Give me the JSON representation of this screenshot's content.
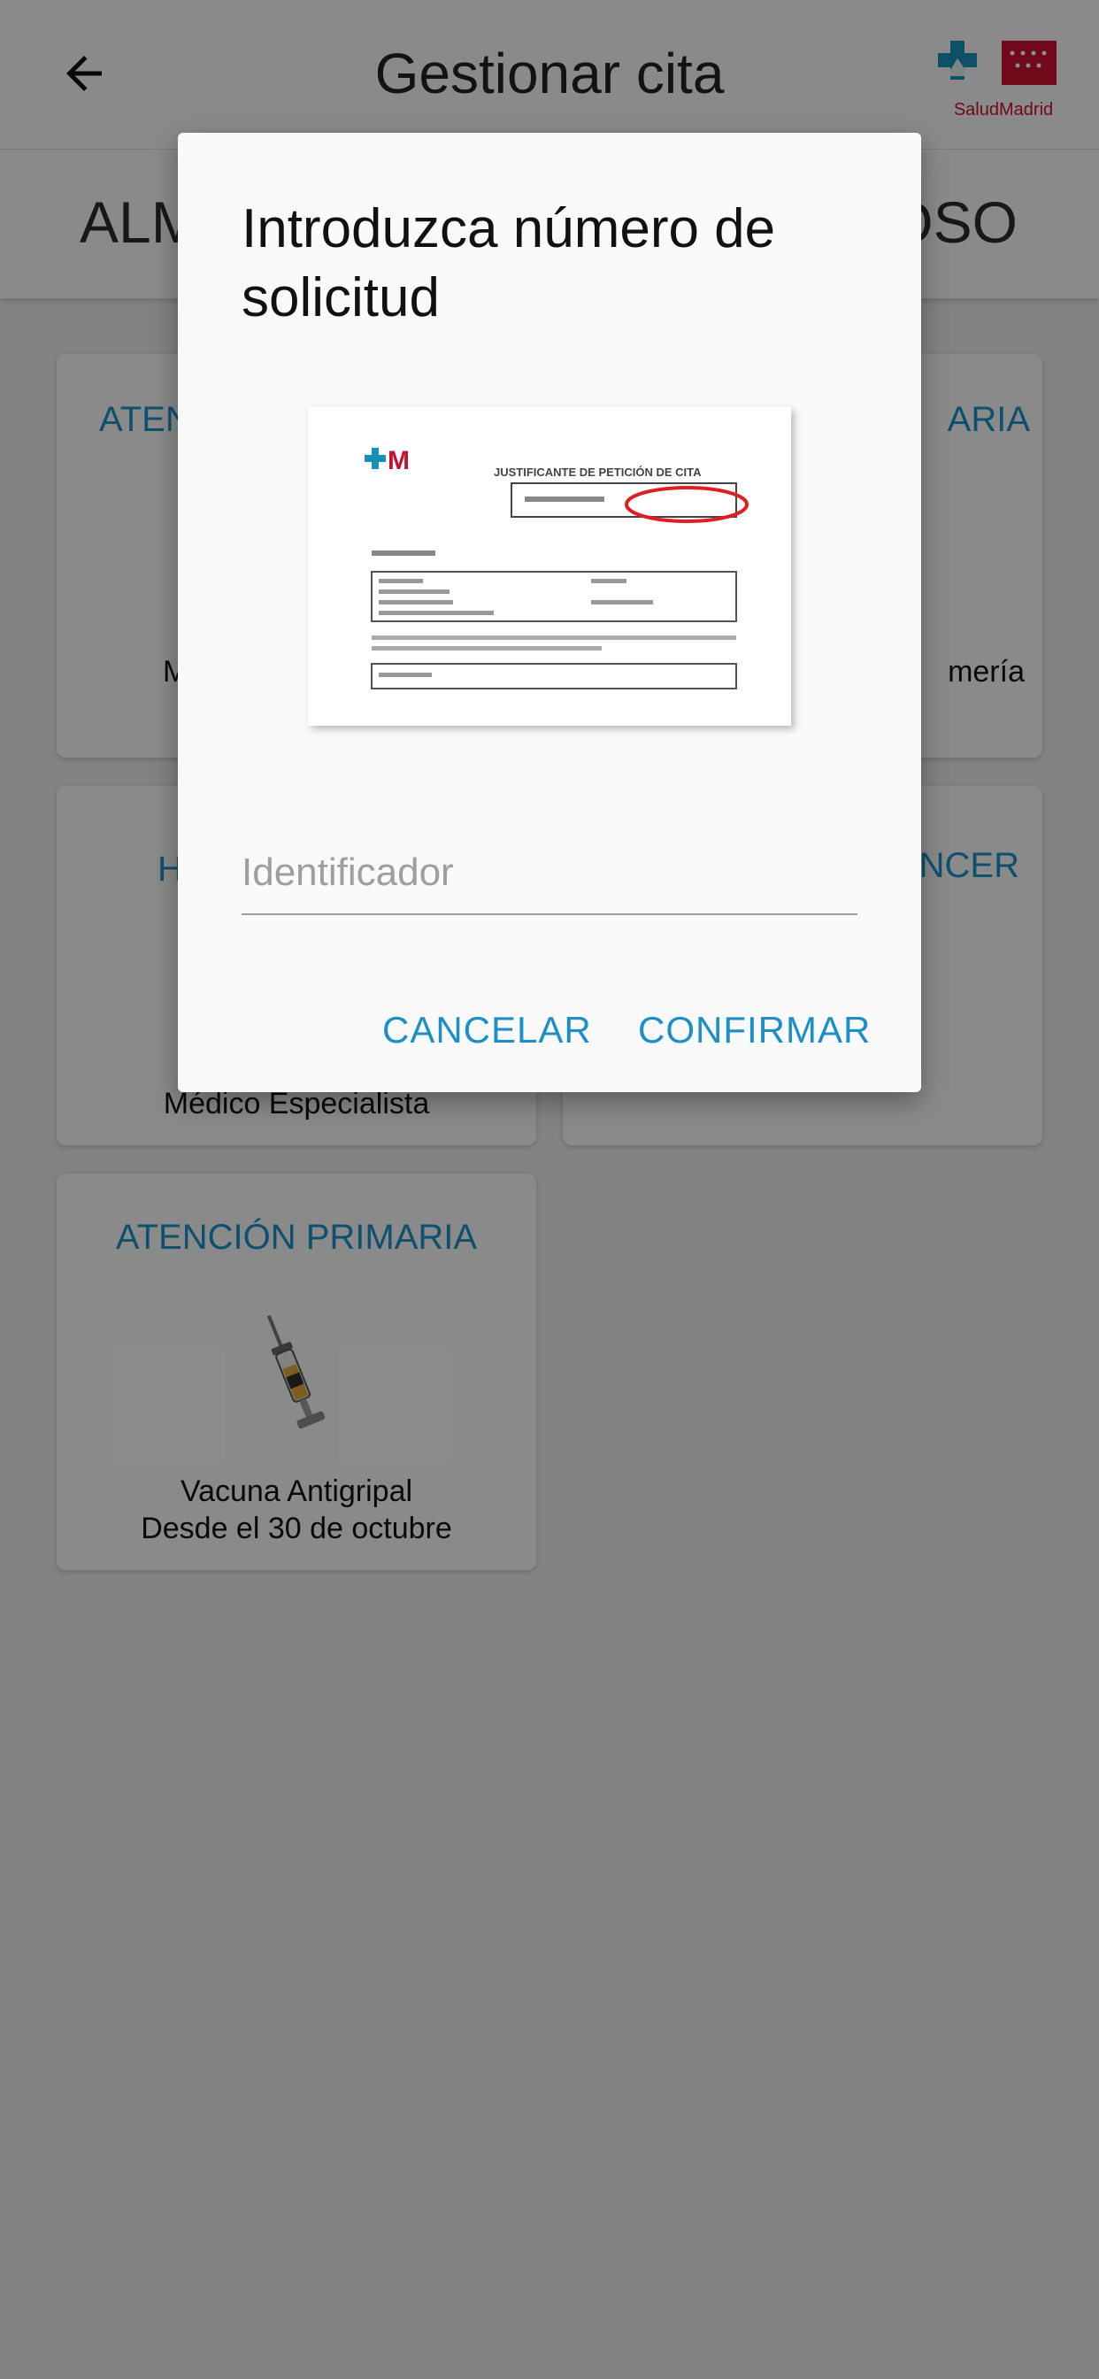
{
  "appbar": {
    "title": "Gestionar cita",
    "back_icon": "arrow-left-icon",
    "brand": "SaludMadrid"
  },
  "tabs": {
    "left_label": "ALM",
    "right_label": "OSO"
  },
  "cards": [
    {
      "title": "ATEN",
      "desc": "M"
    },
    {
      "title": "ARIA",
      "desc": "mería"
    },
    {
      "title": "H",
      "desc": "Médico Especialista"
    },
    {
      "title": "NCER",
      "desc": ""
    },
    {
      "title": "ATENCIÓN PRIMARIA",
      "desc_line1": "Vacuna Antigripal",
      "desc_line2": "Desde el 30 de octubre",
      "icon": "syringe-icon"
    }
  ],
  "dialog": {
    "title": "Introduzca número de solicitud",
    "image_caption": "JUSTIFICANTE DE PETICIÓN DE CITA",
    "field_placeholder": "Identificador",
    "field_value": "",
    "cancel_label": "CANCELAR",
    "confirm_label": "CONFIRMAR"
  },
  "colors": {
    "accent": "#1b8fc6",
    "brand_red": "#c8102e",
    "brand_teal": "#1a8fb4"
  }
}
